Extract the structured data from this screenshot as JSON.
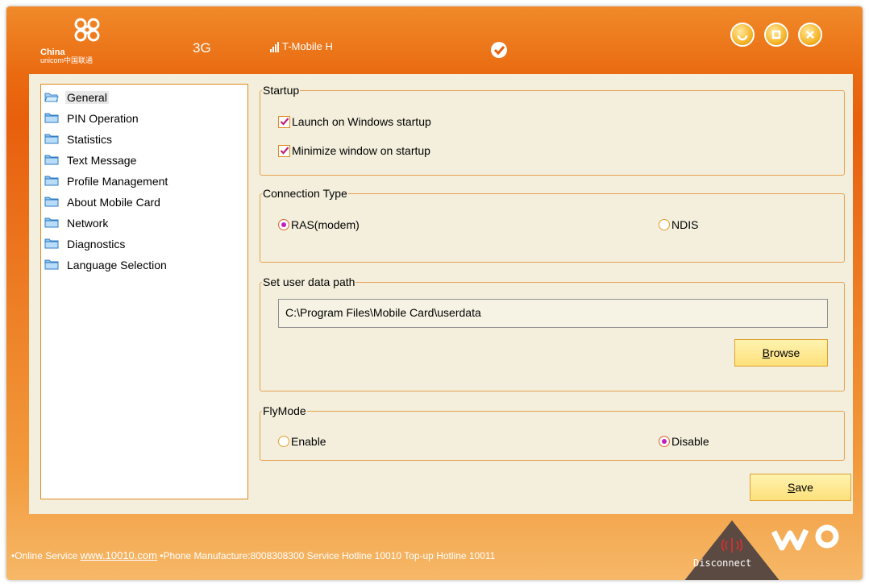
{
  "app": {
    "logo_line1": "China",
    "logo_line2": "unicom中国联通",
    "network_type": "3G",
    "operator": "T-Mobile H"
  },
  "colors": {
    "brand_orange": "#e85f0c",
    "panel_bg": "#f3efdc",
    "border_orange": "#e08a20",
    "radio_dot": "#c020c0"
  },
  "sidebar": {
    "items": [
      {
        "label": "General",
        "icon": "folder-open-icon",
        "selected": true
      },
      {
        "label": "PIN Operation",
        "icon": "folder-icon"
      },
      {
        "label": "Statistics",
        "icon": "folder-icon"
      },
      {
        "label": "Text Message",
        "icon": "folder-icon"
      },
      {
        "label": "Profile Management",
        "icon": "folder-icon"
      },
      {
        "label": "About Mobile Card",
        "icon": "folder-icon"
      },
      {
        "label": "Network",
        "icon": "folder-icon"
      },
      {
        "label": "Diagnostics",
        "icon": "folder-icon"
      },
      {
        "label": "Language Selection",
        "icon": "folder-icon"
      }
    ]
  },
  "startup": {
    "title": "Startup",
    "launch_label": "Launch on Windows startup",
    "launch_checked": true,
    "minimize_label": "Minimize window on startup",
    "minimize_checked": true
  },
  "connection": {
    "title": "Connection Type",
    "ras_label": "RAS(modem)",
    "ndis_label": "NDIS",
    "selected": "RAS(modem)"
  },
  "userpath": {
    "title": "Set user data path",
    "value": "C:\\Program Files\\Mobile Card\\userdata",
    "browse_first": "B",
    "browse_rest": "rowse"
  },
  "flymode": {
    "title": "FlyMode",
    "enable_label": "Enable",
    "disable_label": "Disable",
    "selected": "Disable"
  },
  "save": {
    "first": "S",
    "rest": "ave"
  },
  "footer": {
    "bullet1": "•Online Service ",
    "link": "www.10010.com",
    "bullet2": " •Phone Manufacture:8008308300 Service Hotline 10010 Top-up Hotline 10011",
    "disconnect": "Disconnect"
  }
}
